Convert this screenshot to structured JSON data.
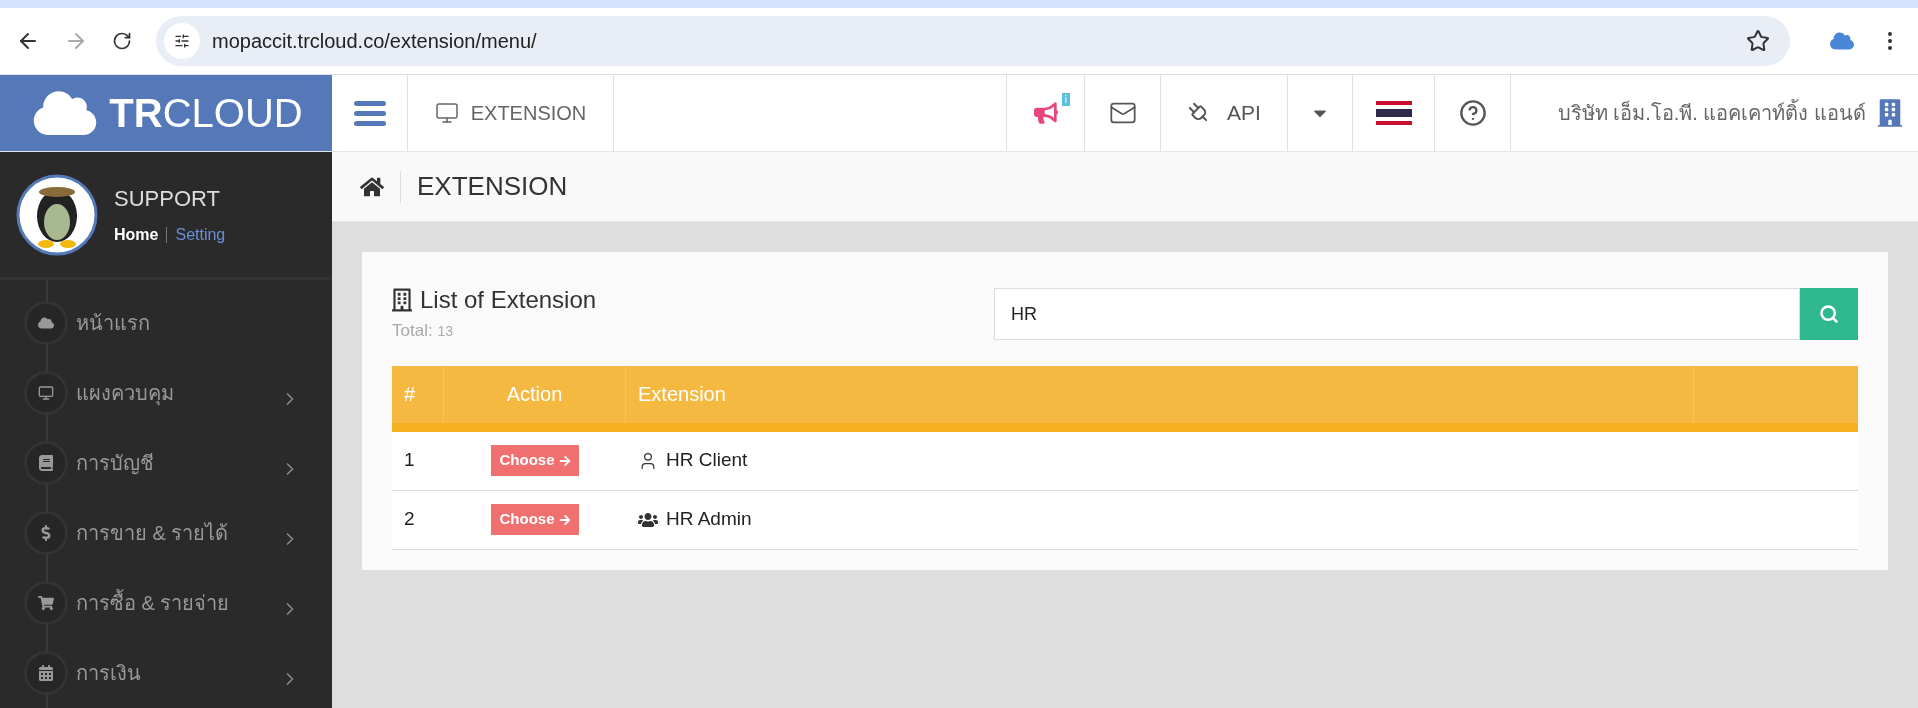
{
  "browser": {
    "url": "mopaccit.trcloud.co/extension/menu/"
  },
  "header": {
    "logo_bold": "TR",
    "logo_light": "CLOUD",
    "page_label": "EXTENSION",
    "notification_badge": "i",
    "api_label": "API",
    "company": "บริษัท เอ็ม.โอ.พี. แอคเคาท์ติ้ง แอนด์"
  },
  "profile": {
    "name": "SUPPORT",
    "links": [
      {
        "label": "Home",
        "selected": true
      },
      {
        "label": "Setting",
        "selected": false
      }
    ]
  },
  "sidebar": {
    "items": [
      {
        "kind": "cloud",
        "label": "หน้าแรก",
        "expandable": false
      },
      {
        "kind": "monitor",
        "label": "แผงควบคุม",
        "expandable": true
      },
      {
        "kind": "book",
        "label": "การบัญชี",
        "expandable": true
      },
      {
        "kind": "dollar",
        "label": "การขาย & รายได้",
        "expandable": true
      },
      {
        "kind": "cart",
        "label": "การซื้อ & รายจ่าย",
        "expandable": true
      },
      {
        "kind": "calendar",
        "label": "การเงิน",
        "expandable": true
      }
    ]
  },
  "breadcrumb": {
    "title": "EXTENSION"
  },
  "card": {
    "title": "List of Extension",
    "total_label": "Total:",
    "total_value": "13",
    "search": {
      "value": "HR"
    },
    "table": {
      "columns": [
        "#",
        "Action",
        "Extension"
      ],
      "rows": [
        {
          "number": "1",
          "action": "Choose",
          "kind": "single",
          "name": "HR Client"
        },
        {
          "number": "2",
          "action": "Choose",
          "kind": "group",
          "name": "HR Admin"
        }
      ]
    }
  }
}
